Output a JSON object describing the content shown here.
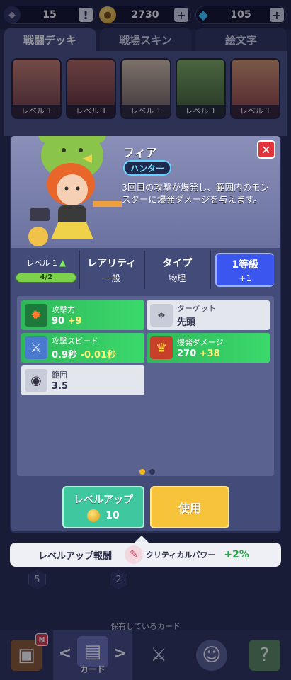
{
  "topbar": {
    "rank": "15",
    "alert": "!",
    "gold": "2730",
    "gems": "105",
    "plus": "+"
  },
  "tabs": [
    {
      "label": "戦闘デッキ"
    },
    {
      "label": "戦場スキン"
    },
    {
      "label": "絵文字"
    }
  ],
  "deck": {
    "level_label": "レベル 1"
  },
  "modal": {
    "close": "✕",
    "name": "フィア",
    "class": "ハンター",
    "description": "3回目の攻撃が爆発し、範囲内のモンスターに爆発ダメージを与えます。",
    "level": {
      "label": "レベル 1",
      "progress": "4/2"
    },
    "rarity": {
      "title": "レアリティ",
      "value": "一般"
    },
    "type": {
      "title": "タイプ",
      "value": "物理"
    },
    "grade": {
      "title": "1等級",
      "value": "+1"
    },
    "stats": [
      {
        "label": "攻撃力",
        "value": "90",
        "bonus": "+9",
        "style": "green",
        "icon": "fire-icon"
      },
      {
        "label": "ターゲット",
        "value": "先頭",
        "bonus": "",
        "style": "white",
        "icon": "crosshair-icon"
      },
      {
        "label": "攻撃スピード",
        "value": "0.9秒",
        "bonus": "-0.01秒",
        "style": "green",
        "icon": "sword-icon"
      },
      {
        "label": "爆発ダメージ",
        "value": "270",
        "bonus": "+38",
        "style": "green",
        "icon": "crown-icon"
      },
      {
        "label": "範囲",
        "value": "3.5",
        "bonus": "",
        "style": "white",
        "icon": "range-icon"
      }
    ],
    "levelup_button": {
      "label": "レベルアップ",
      "cost": "10"
    },
    "use_button": {
      "label": "使用"
    }
  },
  "reward": {
    "title": "レベルアップ報酬",
    "name": "クリティカルパワー",
    "value": "+2%"
  },
  "background": {
    "card_numbers": [
      "5",
      "2"
    ],
    "owned_label": "保有しているカード"
  },
  "nav": {
    "badge": "N",
    "cards_label": "カード",
    "left_arrow": "<",
    "right_arrow": ">"
  }
}
